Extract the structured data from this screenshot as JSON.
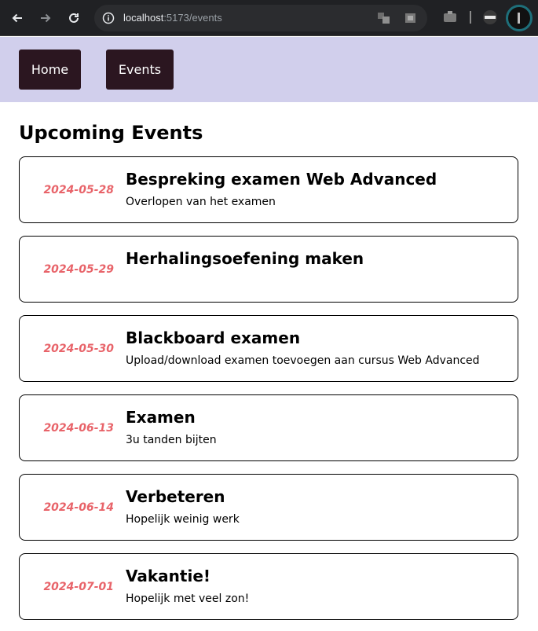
{
  "browser": {
    "url_host": "localhost",
    "url_path": ":5173/events"
  },
  "nav": {
    "home_label": "Home",
    "events_label": "Events",
    "background": "#d1cfec",
    "button_color": "#2b1620"
  },
  "page": {
    "title": "Upcoming Events"
  },
  "events": [
    {
      "date": "2024-05-28",
      "title": "Bespreking examen Web Advanced",
      "description": "Overlopen van het examen"
    },
    {
      "date": "2024-05-29",
      "title": "Herhalingsoefening maken",
      "description": ""
    },
    {
      "date": "2024-05-30",
      "title": "Blackboard examen",
      "description": "Upload/download examen toevoegen aan cursus Web Advanced"
    },
    {
      "date": "2024-06-13",
      "title": "Examen",
      "description": "3u tanden bijten"
    },
    {
      "date": "2024-06-14",
      "title": "Verbeteren",
      "description": "Hopelijk weinig werk"
    },
    {
      "date": "2024-07-01",
      "title": "Vakantie!",
      "description": "Hopelijk met veel zon!"
    }
  ],
  "colors": {
    "date_color": "#e8646a"
  },
  "icons": {
    "back": "arrow-left-icon",
    "forward": "arrow-right-icon",
    "reload": "reload-icon",
    "info": "info-icon"
  }
}
